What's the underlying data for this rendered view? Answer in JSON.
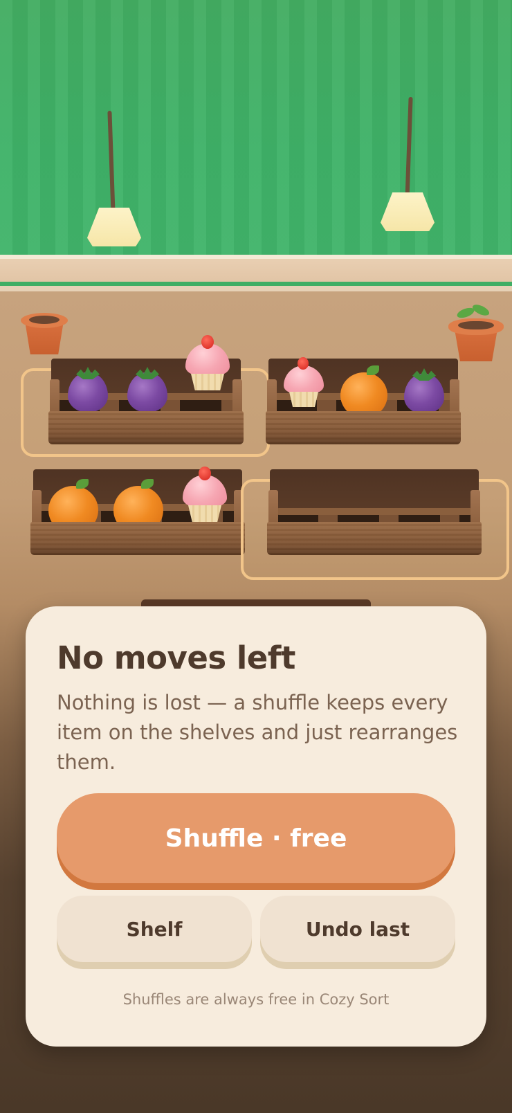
{
  "board": {
    "shelves": [
      {
        "name": "shelf-1",
        "selected": true,
        "items": [
          "eggplant",
          "eggplant",
          "cupcake"
        ]
      },
      {
        "name": "shelf-2",
        "selected": false,
        "items": [
          "cupcake",
          "orange",
          "eggplant"
        ]
      },
      {
        "name": "shelf-3",
        "selected": false,
        "items": [
          "orange",
          "orange",
          "cupcake"
        ]
      },
      {
        "name": "shelf-4",
        "selected": true,
        "items": []
      }
    ],
    "decor": [
      "lamp-icon",
      "lamp-icon",
      "flower-pot-icon",
      "sprout-pot-icon"
    ]
  },
  "dialog": {
    "title": "No moves left",
    "message": "Nothing is lost — a shuffle keeps every item on the shelves and just rearranges them.",
    "primary_label": "Shuffle · free",
    "shelf_label": "Shelf",
    "undo_label": "Undo last",
    "footnote": "Shuffles are always free in Cozy Sort"
  },
  "colors": {
    "wall": "#43ad62",
    "card": "#f7ecdd",
    "primary_button": "#e69a6b",
    "secondary_button": "#f0e2d1",
    "title_text": "#4e3a2c"
  }
}
